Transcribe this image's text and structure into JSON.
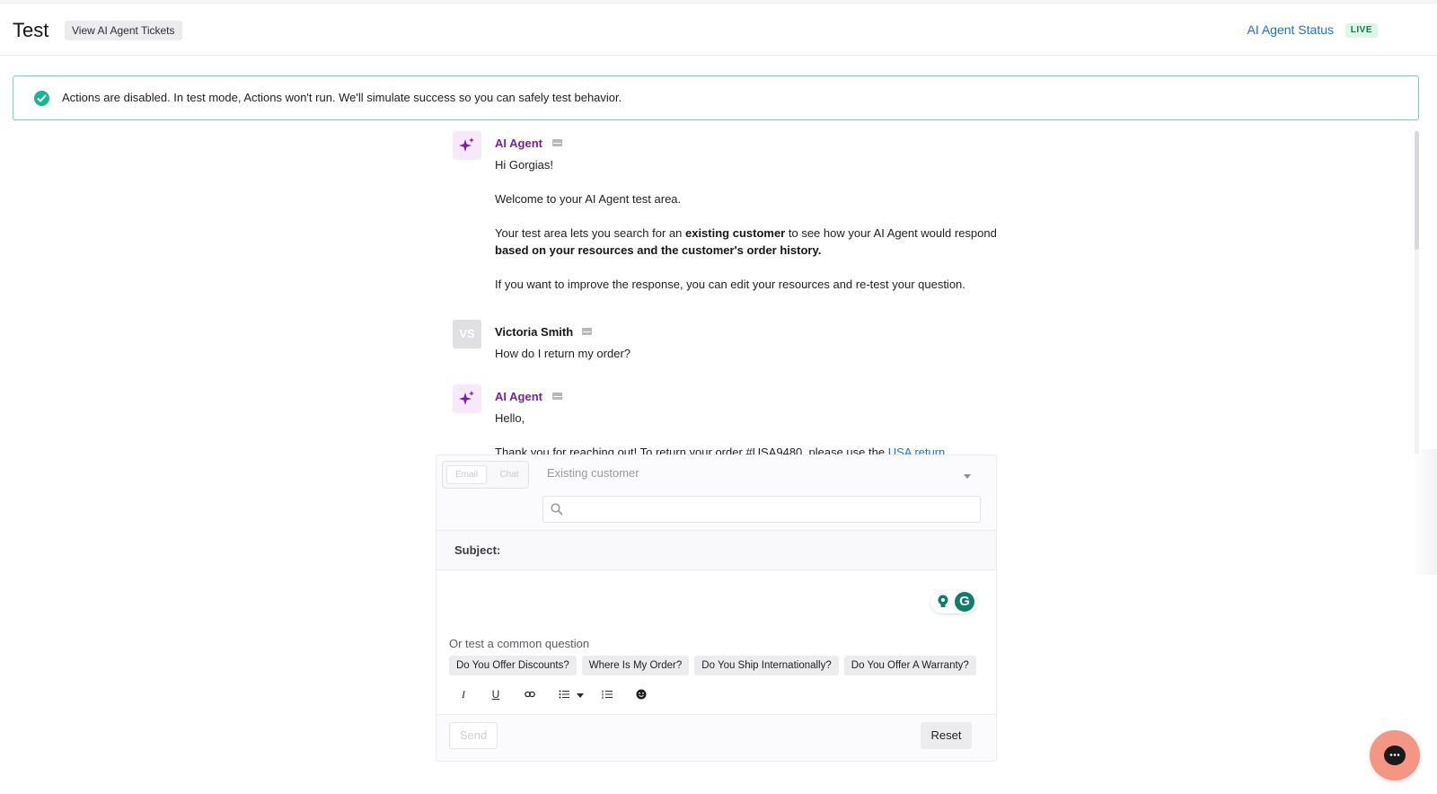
{
  "header": {
    "title": "Test",
    "tickets_button": "View AI Agent Tickets",
    "status_link": "AI Agent Status",
    "status_badge": "LIVE"
  },
  "banner": {
    "text": "Actions are disabled. In test mode, Actions won't run. We'll simulate success so you can safely test behavior."
  },
  "messages": [
    {
      "sender": "AI Agent",
      "greeting": "Hi Gorgias!",
      "p2": "Welcome to your AI Agent test area.",
      "p3_a": "Your test area lets you search for an ",
      "p3_b": "existing customer",
      "p3_c": " to see how your AI Agent would respond ",
      "p3_d": "based on your resources and the customer's order history.",
      "p4": "If you want to improve the response, you can edit your resources and re-test your question."
    },
    {
      "sender": "Victoria Smith",
      "initials": "VS",
      "text": "How do I return my order?"
    },
    {
      "sender": "AI Agent",
      "greeting": "Hello,",
      "text_a": "Thank you for reaching out! To return your order #USA9480, please use the ",
      "link": "USA return"
    }
  ],
  "composer": {
    "channel_email": "Email",
    "channel_chat": "Chat",
    "customer_select": "Existing customer",
    "search_placeholder": "",
    "subject_label": "Subject:",
    "grammarly_letter": "G",
    "common_label": "Or test a common question",
    "chips": [
      "Do You Offer Discounts?",
      "Where Is My Order?",
      "Do You Ship Internationally?",
      "Do You Offer A Warranty?"
    ],
    "send_label": "Send",
    "reset_label": "Reset"
  },
  "colors": {
    "accent_link": "#1c70d8",
    "ai_agent": "#7a1fa2",
    "success": "#14b88e",
    "launcher": "#f59583"
  }
}
